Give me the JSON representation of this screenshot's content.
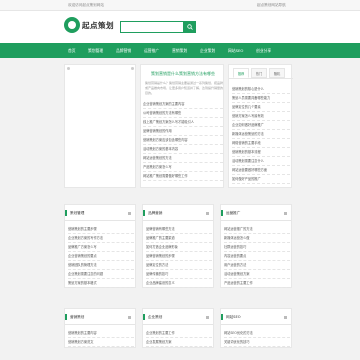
{
  "topbar": {
    "left": "欢迎访问起点策划网站",
    "right": "起点策划网站导航"
  },
  "header": {
    "logo_text": "起点策划",
    "search_placeholder": ""
  },
  "nav": [
    "首页",
    "策划管理",
    "品牌营销",
    "运营推广",
    "营销策划",
    "企业策划",
    "网站SEO",
    "创业分享"
  ],
  "news": {
    "headline": "策划营销是什么策划营销方法有哪些",
    "intro": "策划营销是什么？策划营销主要是通过一系列策划，把品牌或产品推向市场，让更多用户知道并了解，达到提升销量的目的。",
    "items": [
      "企业营销策划方案的主要内容",
      "公司营销策划的方法有哪些",
      "线上推广策划方案怎么写才能吸引人",
      "品牌营销策划的作用",
      "营销策划方案应该包含哪些内容",
      "活动策划方案的基本内容",
      "网站运营策划的方法",
      "产品策划方案怎么写",
      "网站推广策划需要做好哪些工作"
    ]
  },
  "tabbox": {
    "tabs": [
      "推荐",
      "热门",
      "随机"
    ],
    "items": [
      "营销策划的核心是什么",
      "策划人员需要具备哪些能力",
      "品牌定位的几个要素",
      "营销方案怎么写最有效",
      "企业如何做好品牌推广",
      "新媒体运营策划的方法",
      "网络营销的主要手段",
      "营销策划的基本流程",
      "活动策划需要注意什么",
      "网站运营要做好哪些方面",
      "如何做好产品的推广"
    ]
  },
  "panels": [
    {
      "title": "策划管理",
      "items": [
        "营销策划的主要步骤",
        "企业策划方案的写作方法",
        "品牌推广方案怎么写",
        "企业营销策划的要点",
        "营销团队的管理方法",
        "企业策划需要注意的问题",
        "策划方案的基本格式"
      ]
    },
    {
      "title": "品牌营销",
      "items": [
        "品牌营销有哪些方法",
        "品牌推广的主要渠道",
        "如何打造企业品牌形象",
        "品牌营销策划的步骤",
        "品牌定位的方法",
        "品牌传播的技巧",
        "企业品牌建设的意义"
      ]
    },
    {
      "title": "运营推广",
      "items": [
        "网站运营推广的方法",
        "新媒体运营怎么做",
        "社群运营的技巧",
        "内容运营的要点",
        "用户运营的方法",
        "活动运营策划方案",
        "产品运营的主要工作"
      ]
    },
    {
      "title": "营销策划",
      "items": [
        "营销策划的主要内容",
        "营销策划方案范文"
      ]
    },
    {
      "title": "企业策划",
      "items": [
        "企业策划的主要工作",
        "企业发展策划方案"
      ]
    },
    {
      "title": "网站SEO",
      "items": [
        "网站SEO优化的方法",
        "关键词优化的技巧"
      ]
    }
  ],
  "colors": {
    "brand": "#1f9e5e"
  }
}
